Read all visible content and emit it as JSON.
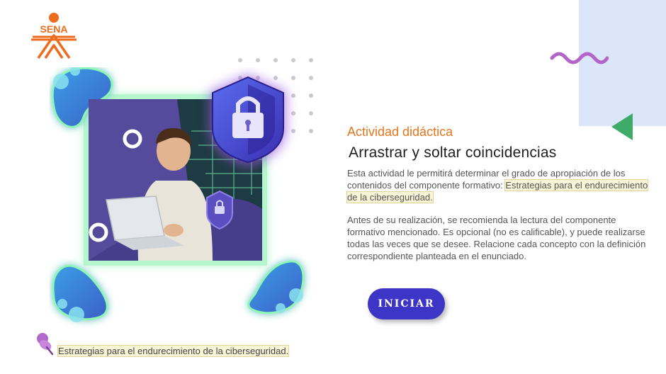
{
  "logo": {
    "text": "SENA",
    "color": "#ec6b1c"
  },
  "activity": {
    "label": "Actividad didáctica",
    "title": "Arrastrar y soltar coincidencias",
    "paragraph1_pre": "Esta actividad le permitirá determinar el grado de apropiación de los contenidos del componente formativo: ",
    "paragraph1_highlight": "Estrategias para el endurecimiento de la ciberseguridad.",
    "paragraph2": "Antes de su realización, se recomienda la lectura del componente formativo mencionado. Es opcional (no es calificable), y puede realizarse todas las veces que se desee. Relacione cada concepto con la definición correspondiente planteada en el enunciado."
  },
  "start_button": {
    "label": "INICIAR"
  },
  "footer": {
    "text": "Estrategias para el endurecimiento de la ciberseguridad."
  },
  "icons": [
    "sena-logo-icon",
    "lock-shield-icon",
    "pushpin-icon",
    "wave-decoration",
    "triangle-decoration"
  ],
  "colors": {
    "accent_orange": "#e8751e",
    "button": "#3c35c6",
    "panel": "#dce6fb",
    "purple": "#5b4aa0",
    "green": "#3eab68"
  }
}
